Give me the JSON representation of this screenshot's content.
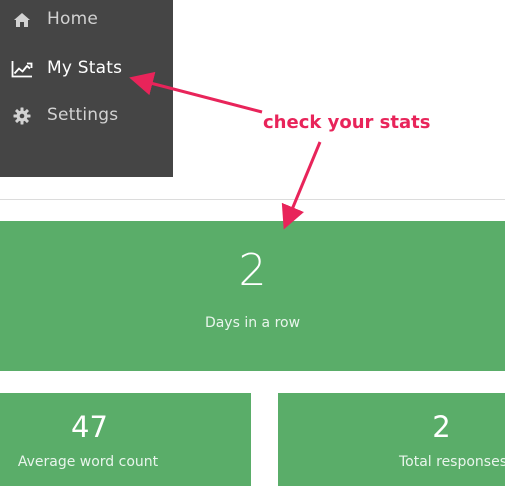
{
  "sidebar": {
    "items": [
      {
        "label": "Home",
        "icon": "home-icon",
        "active": false
      },
      {
        "label": "My Stats",
        "icon": "line-chart-icon",
        "active": true
      },
      {
        "label": "Settings",
        "icon": "gear-icon",
        "active": false
      }
    ],
    "background": "#454545"
  },
  "stats": {
    "streak": {
      "value": "2",
      "caption": "Days in a row"
    },
    "word_count": {
      "value": "47",
      "caption": "Average word count"
    },
    "responses": {
      "value": "2",
      "caption": "Total responses"
    },
    "card_color": "#5aad69"
  },
  "annotation": {
    "text": "check your stats",
    "color": "#e8245a"
  }
}
